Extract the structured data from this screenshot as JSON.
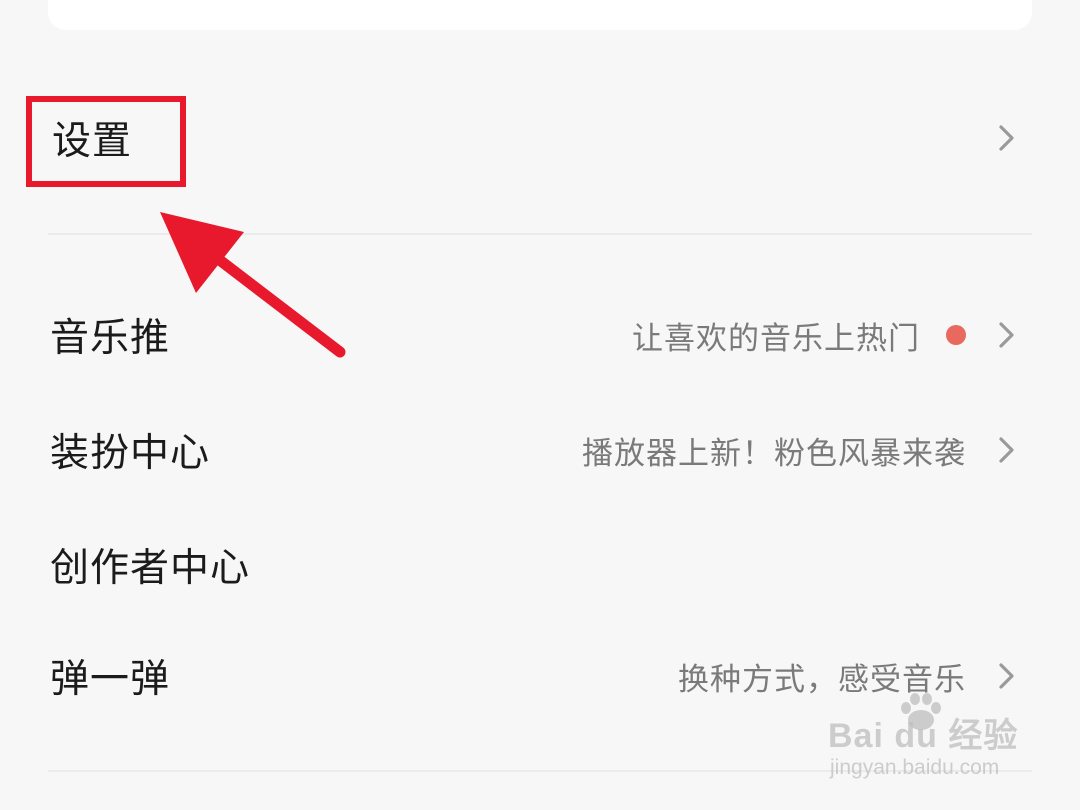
{
  "settings": {
    "label": "设置"
  },
  "menu": {
    "items": [
      {
        "title": "音乐推",
        "subtitle": "让喜欢的音乐上热门",
        "has_dot": true
      },
      {
        "title": "装扮中心",
        "subtitle": "播放器上新！粉色风暴来袭",
        "has_dot": false
      },
      {
        "title": "创作者中心"
      },
      {
        "title": "弹一弹",
        "subtitle": "换种方式，感受音乐",
        "has_dot": false
      }
    ]
  },
  "icons": {
    "chevron": "chevron-right-icon",
    "dot": "notification-dot-icon",
    "arrow": "annotation-arrow-icon",
    "watermark": "baidu-paw-icon"
  },
  "colors": {
    "annotation_red": "#e8192c",
    "notification_dot": "#e86a5f",
    "chevron": "#9a9a9a",
    "background": "#f7f7f7"
  },
  "watermark": {
    "brand": "Bai du 经验",
    "url": "jingyan.baidu.com"
  }
}
